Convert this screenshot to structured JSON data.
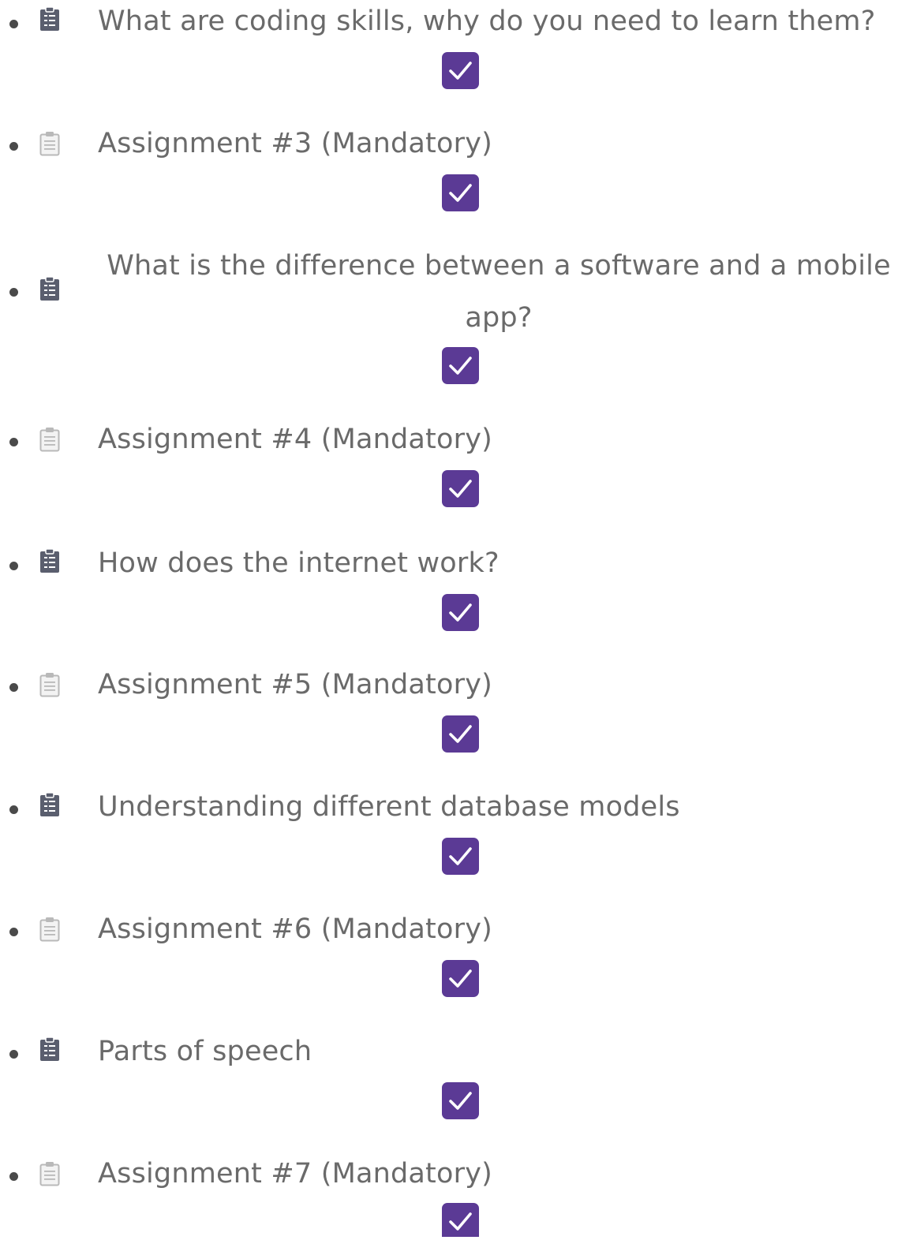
{
  "items": [
    {
      "title": "What are coding skills, why do you need to learn them?",
      "icon": "clipboard-checklist-icon",
      "completed": true
    },
    {
      "title": "Assignment #3 (Mandatory)",
      "icon": "clipboard-icon",
      "completed": true
    },
    {
      "title": "What is the difference between a software and a mobile app?",
      "icon": "clipboard-checklist-icon",
      "completed": true
    },
    {
      "title": "Assignment #4 (Mandatory)",
      "icon": "clipboard-icon",
      "completed": true
    },
    {
      "title": "How does the internet work?",
      "icon": "clipboard-checklist-icon",
      "completed": true
    },
    {
      "title": "Assignment #5 (Mandatory)",
      "icon": "clipboard-icon",
      "completed": true
    },
    {
      "title": "Understanding different database models",
      "icon": "clipboard-checklist-icon",
      "completed": true
    },
    {
      "title": "Assignment #6 (Mandatory)",
      "icon": "clipboard-icon",
      "completed": true
    },
    {
      "title": "Parts of speech",
      "icon": "clipboard-checklist-icon",
      "completed": true
    },
    {
      "title": "Assignment #7 (Mandatory)",
      "icon": "clipboard-icon",
      "completed": true
    }
  ],
  "colors": {
    "check_fill": "#5b3a95",
    "text": "#6a6a6a",
    "bullet": "#4a4a4a",
    "lesson_icon": "#5a5e6e",
    "assignment_icon": "#b9b9b9"
  }
}
